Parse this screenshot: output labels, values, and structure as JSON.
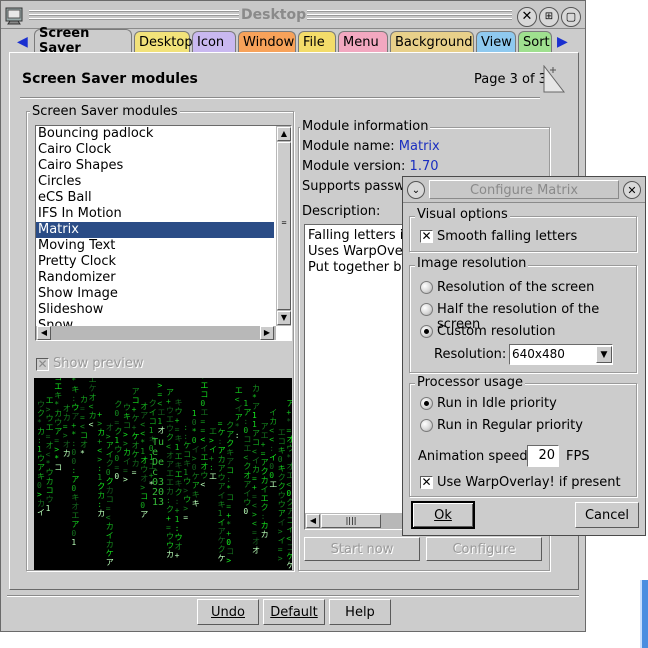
{
  "window": {
    "title": "Desktop",
    "tabs": [
      {
        "label": "Screen Saver",
        "color": "#cccccc"
      },
      {
        "label": "Desktop",
        "color": "#f2e27a"
      },
      {
        "label": "Icon",
        "color": "#c9b8f0"
      },
      {
        "label": "Window",
        "color": "#f7a25a"
      },
      {
        "label": "File",
        "color": "#f3dc6a"
      },
      {
        "label": "Menu",
        "color": "#f2a8c0"
      },
      {
        "label": "Background",
        "color": "#e8d08a"
      },
      {
        "label": "View",
        "color": "#8fc9ef"
      },
      {
        "label": "Sort",
        "color": "#9fe08f"
      }
    ],
    "page_title": "Screen Saver modules",
    "page_indicator": "Page 3 of 3"
  },
  "modules": {
    "group_label": "Screen Saver modules",
    "items": [
      "Bouncing padlock",
      "Cairo Clock",
      "Cairo Shapes",
      "Circles",
      "eCS Ball",
      "IFS In Motion",
      "Matrix",
      "Moving Text",
      "Pretty Clock",
      "Randomizer",
      "Show Image",
      "Slideshow",
      "Snow"
    ],
    "selected": "Matrix",
    "show_preview": "Show preview",
    "preview_text": "Tue Dec 03 2013"
  },
  "module_info": {
    "group_label": "Module information",
    "name_label": "Module name:",
    "name_value": "Matrix",
    "version_label": "Module version:",
    "version_value": "1.70",
    "supports_label": "Supports passwo",
    "description_label": "Description:",
    "description_lines": [
      "Falling letters in",
      "Uses WarpOver",
      "Put together by D"
    ],
    "start_now": "Start now",
    "configure": "Configure"
  },
  "bottom_buttons": {
    "undo": "Undo",
    "default": "Default",
    "help": "Help"
  },
  "dialog": {
    "title": "Configure Matrix",
    "visual_options": {
      "label": "Visual options",
      "smooth": "Smooth falling letters",
      "smooth_checked": true
    },
    "image_resolution": {
      "label": "Image resolution",
      "options": [
        "Resolution of the screen",
        "Half the resolution of the screen",
        "Custom resolution"
      ],
      "selected": "Custom resolution",
      "resolution_label": "Resolution:",
      "resolution_value": "640x480"
    },
    "processor_usage": {
      "label": "Processor usage",
      "options": [
        "Run in Idle priority",
        "Run in Regular priority"
      ],
      "selected": "Run in Idle priority",
      "speed_label": "Animation speed:",
      "speed_value": "20",
      "speed_unit": "FPS",
      "warp": "Use WarpOverlay! if present",
      "warp_checked": true
    },
    "ok": "Ok",
    "cancel": "Cancel"
  }
}
